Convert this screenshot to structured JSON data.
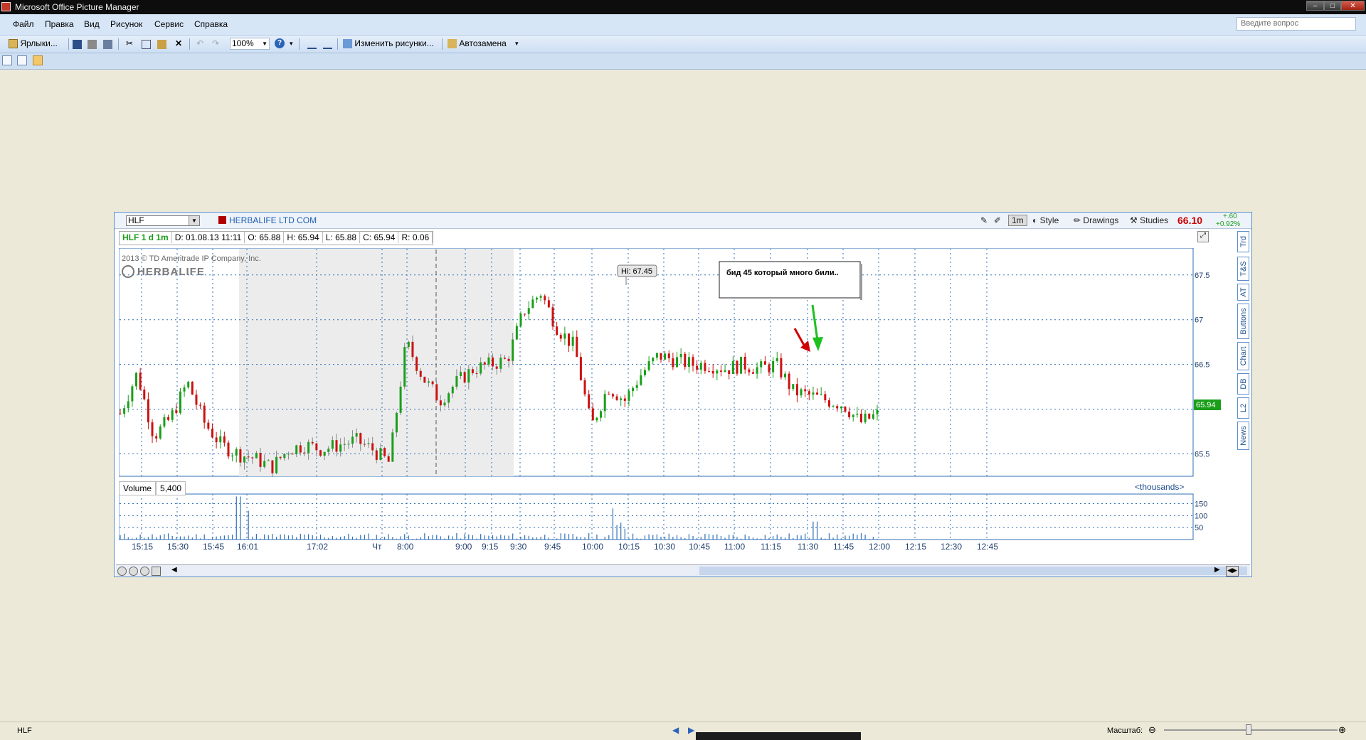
{
  "window": {
    "title": "Microsoft Office Picture Manager",
    "min": "–",
    "max": "□",
    "close": "✕"
  },
  "menu": [
    {
      "label": "Файл"
    },
    {
      "label": "Правка"
    },
    {
      "label": "Вид"
    },
    {
      "label": "Рисунок"
    },
    {
      "label": "Сервис"
    },
    {
      "label": "Справка"
    }
  ],
  "help_box": {
    "placeholder": "Введите вопрос"
  },
  "toolbar": {
    "shortcuts": "Ярлыки...",
    "zoom": "100%",
    "edit": "Изменить рисунки...",
    "autocorrect": "Автозамена"
  },
  "status": {
    "filename": "HLF",
    "zoom_label": "Масштаб:"
  },
  "chart_header": {
    "symbol": "HLF",
    "company": "HERBALIFE LTD COM",
    "style": "Style",
    "drawings": "Drawings",
    "studies": "Studies",
    "interval": "1m",
    "last": "66.10",
    "change": "+.60",
    "change_pct": "+0.92%"
  },
  "info": {
    "sym": "HLF 1 d 1m",
    "date": "D: 01.08.13 11:11",
    "open": "O: 65.88",
    "high": "H: 65.94",
    "low": "L: 65.88",
    "close": "C: 65.94",
    "range": "R: 0.06"
  },
  "watermark": {
    "copyright": "2013 © TD Ameritrade IP Company, Inc.",
    "brand": "HERBALIFE"
  },
  "annotation": {
    "text": "бид 45 который много били..",
    "hi_label": "Hi: 67.45",
    "last_tag": "65.94"
  },
  "volume": {
    "label": "Volume",
    "value": "5,400",
    "units": "<thousands>"
  },
  "side_tabs": [
    "Trd",
    "T&S",
    "AT",
    "Buttons",
    "Chart",
    "DB",
    "L2",
    "News"
  ],
  "colors": {
    "up": "#1a9e1a",
    "down": "#cc1111",
    "grid": "#2f6fb5",
    "accent": "#cc0000",
    "frame": "#5e8fc9"
  },
  "chart_data": {
    "type": "candlestick",
    "title": "",
    "xlabel": "",
    "ylabel": "",
    "ylim": [
      65.25,
      67.8
    ],
    "yticks": [
      65.5,
      66,
      66.5,
      67,
      67.5
    ],
    "ytick_labels": [
      "65.5",
      "",
      "66.5",
      "67",
      "67.5"
    ],
    "xtick_labels": [
      "15:15",
      "15:30",
      "15:45",
      "16:01",
      "17:02",
      "Чт",
      "8:00",
      "9:00",
      "9:15",
      "9:30",
      "9:45",
      "10:00",
      "10:15",
      "10:30",
      "10:45",
      "11:00",
      "11:15",
      "11:30",
      "11:45",
      "12:00",
      "12:15",
      "12:30",
      "12:45"
    ],
    "volume_yticks": [
      50,
      100,
      150
    ],
    "volume_ylim": [
      0,
      190
    ],
    "high": 67.45,
    "last": 65.94,
    "session_closes": [
      65.95,
      66.4,
      65.7,
      65.9,
      66.3,
      65.85,
      65.6,
      65.5,
      65.45,
      65.35,
      65.55,
      65.6,
      65.55,
      65.6,
      65.65,
      65.55,
      65.4,
      66.75,
      66.35,
      66.1,
      66.3,
      66.45,
      66.5,
      66.55,
      67.1,
      67.3,
      66.9,
      66.7,
      65.8,
      66.25,
      66.1,
      66.4,
      66.6,
      66.55,
      66.5,
      66.5,
      66.45,
      66.5,
      66.45,
      66.5,
      66.2,
      66.15,
      66.1,
      66.05,
      65.85,
      65.94
    ]
  }
}
